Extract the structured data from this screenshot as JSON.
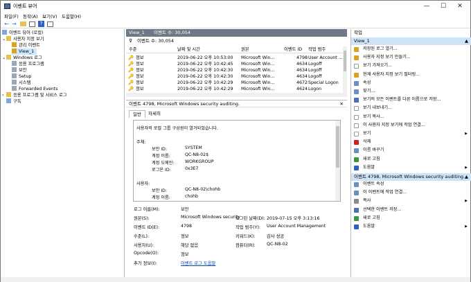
{
  "window": {
    "title": "이벤트 뷰어",
    "minimize": "—",
    "maximize": "☐",
    "close": "✕"
  },
  "menu": [
    "파일(F)",
    "동작(A)",
    "보기(V)",
    "도움말(H)"
  ],
  "tree": [
    {
      "label": "이벤트 뷰어 (로컬)",
      "indent": 0,
      "exp": "",
      "icon": "computer-icon"
    },
    {
      "label": "사용자 지정 보기",
      "indent": 1,
      "exp": "⌄",
      "icon": "folder-icon"
    },
    {
      "label": "관리 이벤트",
      "indent": 2,
      "exp": "",
      "icon": "filter-icon"
    },
    {
      "label": "View_1",
      "indent": 2,
      "exp": "",
      "icon": "filter-icon",
      "selected": true
    },
    {
      "label": "Windows 로그",
      "indent": 1,
      "exp": "⌄",
      "icon": "folder-icon"
    },
    {
      "label": "응용 프로그램",
      "indent": 2,
      "exp": "",
      "icon": "log-icon"
    },
    {
      "label": "보안",
      "indent": 2,
      "exp": "",
      "icon": "log-icon"
    },
    {
      "label": "Setup",
      "indent": 2,
      "exp": "",
      "icon": "log-icon"
    },
    {
      "label": "시스템",
      "indent": 2,
      "exp": "",
      "icon": "log-icon"
    },
    {
      "label": "Forwarded Events",
      "indent": 2,
      "exp": "",
      "icon": "log-icon"
    },
    {
      "label": "응용 프로그램 및 서비스 로그",
      "indent": 1,
      "exp": "›",
      "icon": "folder-icon"
    },
    {
      "label": "구독",
      "indent": 1,
      "exp": "",
      "icon": "subscription-icon"
    }
  ],
  "center": {
    "view_title": "View_1",
    "event_count": "이벤트 수: 30,054",
    "filter_text": "이벤트 수: 30,054",
    "columns": [
      "수준",
      "날짜 및 시간",
      "원본",
      "이벤트 ID",
      "작업 범주"
    ],
    "rows": [
      {
        "level": "정보",
        "datetime": "2019-06-22 오후 10:53:00",
        "source": "Microsoft Win...",
        "id": "4798",
        "category": "User Account ..."
      },
      {
        "level": "정보",
        "datetime": "2019-06-22 오후 10:42:45",
        "source": "Microsoft Win...",
        "id": "4634",
        "category": "Logoff"
      },
      {
        "level": "정보",
        "datetime": "2019-06-22 오후 10:42:30",
        "source": "Microsoft Win...",
        "id": "4634",
        "category": "Logoff"
      },
      {
        "level": "정보",
        "datetime": "2019-06-22 오후 10:42:30",
        "source": "Microsoft Win...",
        "id": "4634",
        "category": "Logoff"
      },
      {
        "level": "정보",
        "datetime": "2019-06-22 오후 10:42:29",
        "source": "Microsoft Win...",
        "id": "4672",
        "category": "Special Logon"
      },
      {
        "level": "정보",
        "datetime": "2019-06-22 오후 10:42:29",
        "source": "Microsoft Win...",
        "id": "4624",
        "category": "Logon"
      }
    ],
    "detail_title": "이벤트 4798, Microsoft Windows security auditing.",
    "tabs": [
      "일반",
      "자세히"
    ],
    "description_lines": [
      "사용자의 로컬 그룹 구성원이 열거되었습니다.",
      "",
      "주체:",
      "보안 ID:|SYSTEM",
      "계정 이름:|QC-N8-02$",
      "계정 도메인:|WORKGROUP",
      "로그온 ID:|0x3E7",
      "",
      "사용자:",
      "보안 ID:|QC-N8-02\\chohb",
      "계정 이름:|chohb",
      "계정 도메인:|QC-N8-02"
    ],
    "fields": {
      "log_name_label": "로그 이름(M):",
      "log_name": "보안",
      "source_label": "원본(S):",
      "source": "Microsoft Windows security",
      "logged_label": "로그된 날짜(D):",
      "logged": "2019-07-15 오후 3:13:16",
      "event_id_label": "이벤트 ID(E):",
      "event_id": "4798",
      "task_label": "작업 범주(Y):",
      "task": "User Account Management",
      "level_label": "수준(L):",
      "level": "정보",
      "keywords_label": "키워드(K):",
      "keywords": "감사 성공",
      "user_label": "사용자(U):",
      "user": "해당 없음",
      "computer_label": "컴퓨터(R):",
      "computer": "QC-N8-02",
      "opcode_label": "Opcode(O):",
      "opcode": "정보",
      "more_label": "추가 정보(I):",
      "more_link": "이벤트 로그 도움말"
    }
  },
  "actions": {
    "header": "작업",
    "section1": "View_1",
    "items1": [
      {
        "label": "저장된 로그 열기...",
        "icon": "open-log-icon",
        "color": "#d9a520",
        "arrow": ""
      },
      {
        "label": "사용자 지정 보기 만들기...",
        "icon": "filter-create-icon",
        "color": "#d9a520",
        "arrow": ""
      },
      {
        "label": "보기 가져오기...",
        "icon": "import-icon",
        "color": "#ffffff",
        "arrow": ""
      },
      {
        "label": "현재 사용자 지정 보기 필터링...",
        "icon": "filter-icon",
        "color": "#d9a520",
        "arrow": ""
      },
      {
        "label": "속성",
        "icon": "properties-icon",
        "color": "#6a8fc0",
        "arrow": ""
      },
      {
        "label": "찾기...",
        "icon": "find-icon",
        "color": "#6a8fc0",
        "arrow": ""
      },
      {
        "label": "보기의 모든 이벤트를 다른 이름으로 저장...",
        "icon": "save-icon",
        "color": "#4a70b0",
        "arrow": ""
      },
      {
        "label": "보기 내보내기...",
        "icon": "export-icon",
        "color": "#ffffff",
        "arrow": ""
      },
      {
        "label": "보기 복사...",
        "icon": "copy-view-icon",
        "color": "#ffffff",
        "arrow": ""
      },
      {
        "label": "이 사용자 지정 보기에 작업 연결...",
        "icon": "attach-task-icon",
        "color": "#ffffff",
        "arrow": ""
      },
      {
        "label": "보기",
        "icon": "view-icon",
        "color": "#ffffff",
        "arrow": "▶"
      },
      {
        "label": "삭제",
        "icon": "delete-icon",
        "color": "#d02020",
        "arrow": ""
      },
      {
        "label": "이름 바꾸기",
        "icon": "rename-icon",
        "color": "#6a8fc0",
        "arrow": ""
      },
      {
        "label": "새로 고침",
        "icon": "refresh-icon",
        "color": "#3a9a3a",
        "arrow": ""
      },
      {
        "label": "도움말",
        "icon": "help-icon",
        "color": "#3060c0",
        "arrow": "▶"
      }
    ],
    "section2": "이벤트 4798, Microsoft Windows security auditing.",
    "items2": [
      {
        "label": "이벤트 속성",
        "icon": "event-properties-icon",
        "color": "#6a8fc0",
        "arrow": ""
      },
      {
        "label": "이 이벤트에 작업 연결...",
        "icon": "attach-task-icon",
        "color": "#6a8fc0",
        "arrow": ""
      },
      {
        "label": "복사",
        "icon": "copy-icon",
        "color": "#8a8a8a",
        "arrow": "▶"
      },
      {
        "label": "선택한 이벤트 저장...",
        "icon": "save-icon",
        "color": "#4a70b0",
        "arrow": ""
      },
      {
        "label": "새로 고침",
        "icon": "refresh-icon",
        "color": "#3a9a3a",
        "arrow": ""
      },
      {
        "label": "도움말",
        "icon": "help-icon",
        "color": "#3060c0",
        "arrow": "▶"
      }
    ]
  }
}
